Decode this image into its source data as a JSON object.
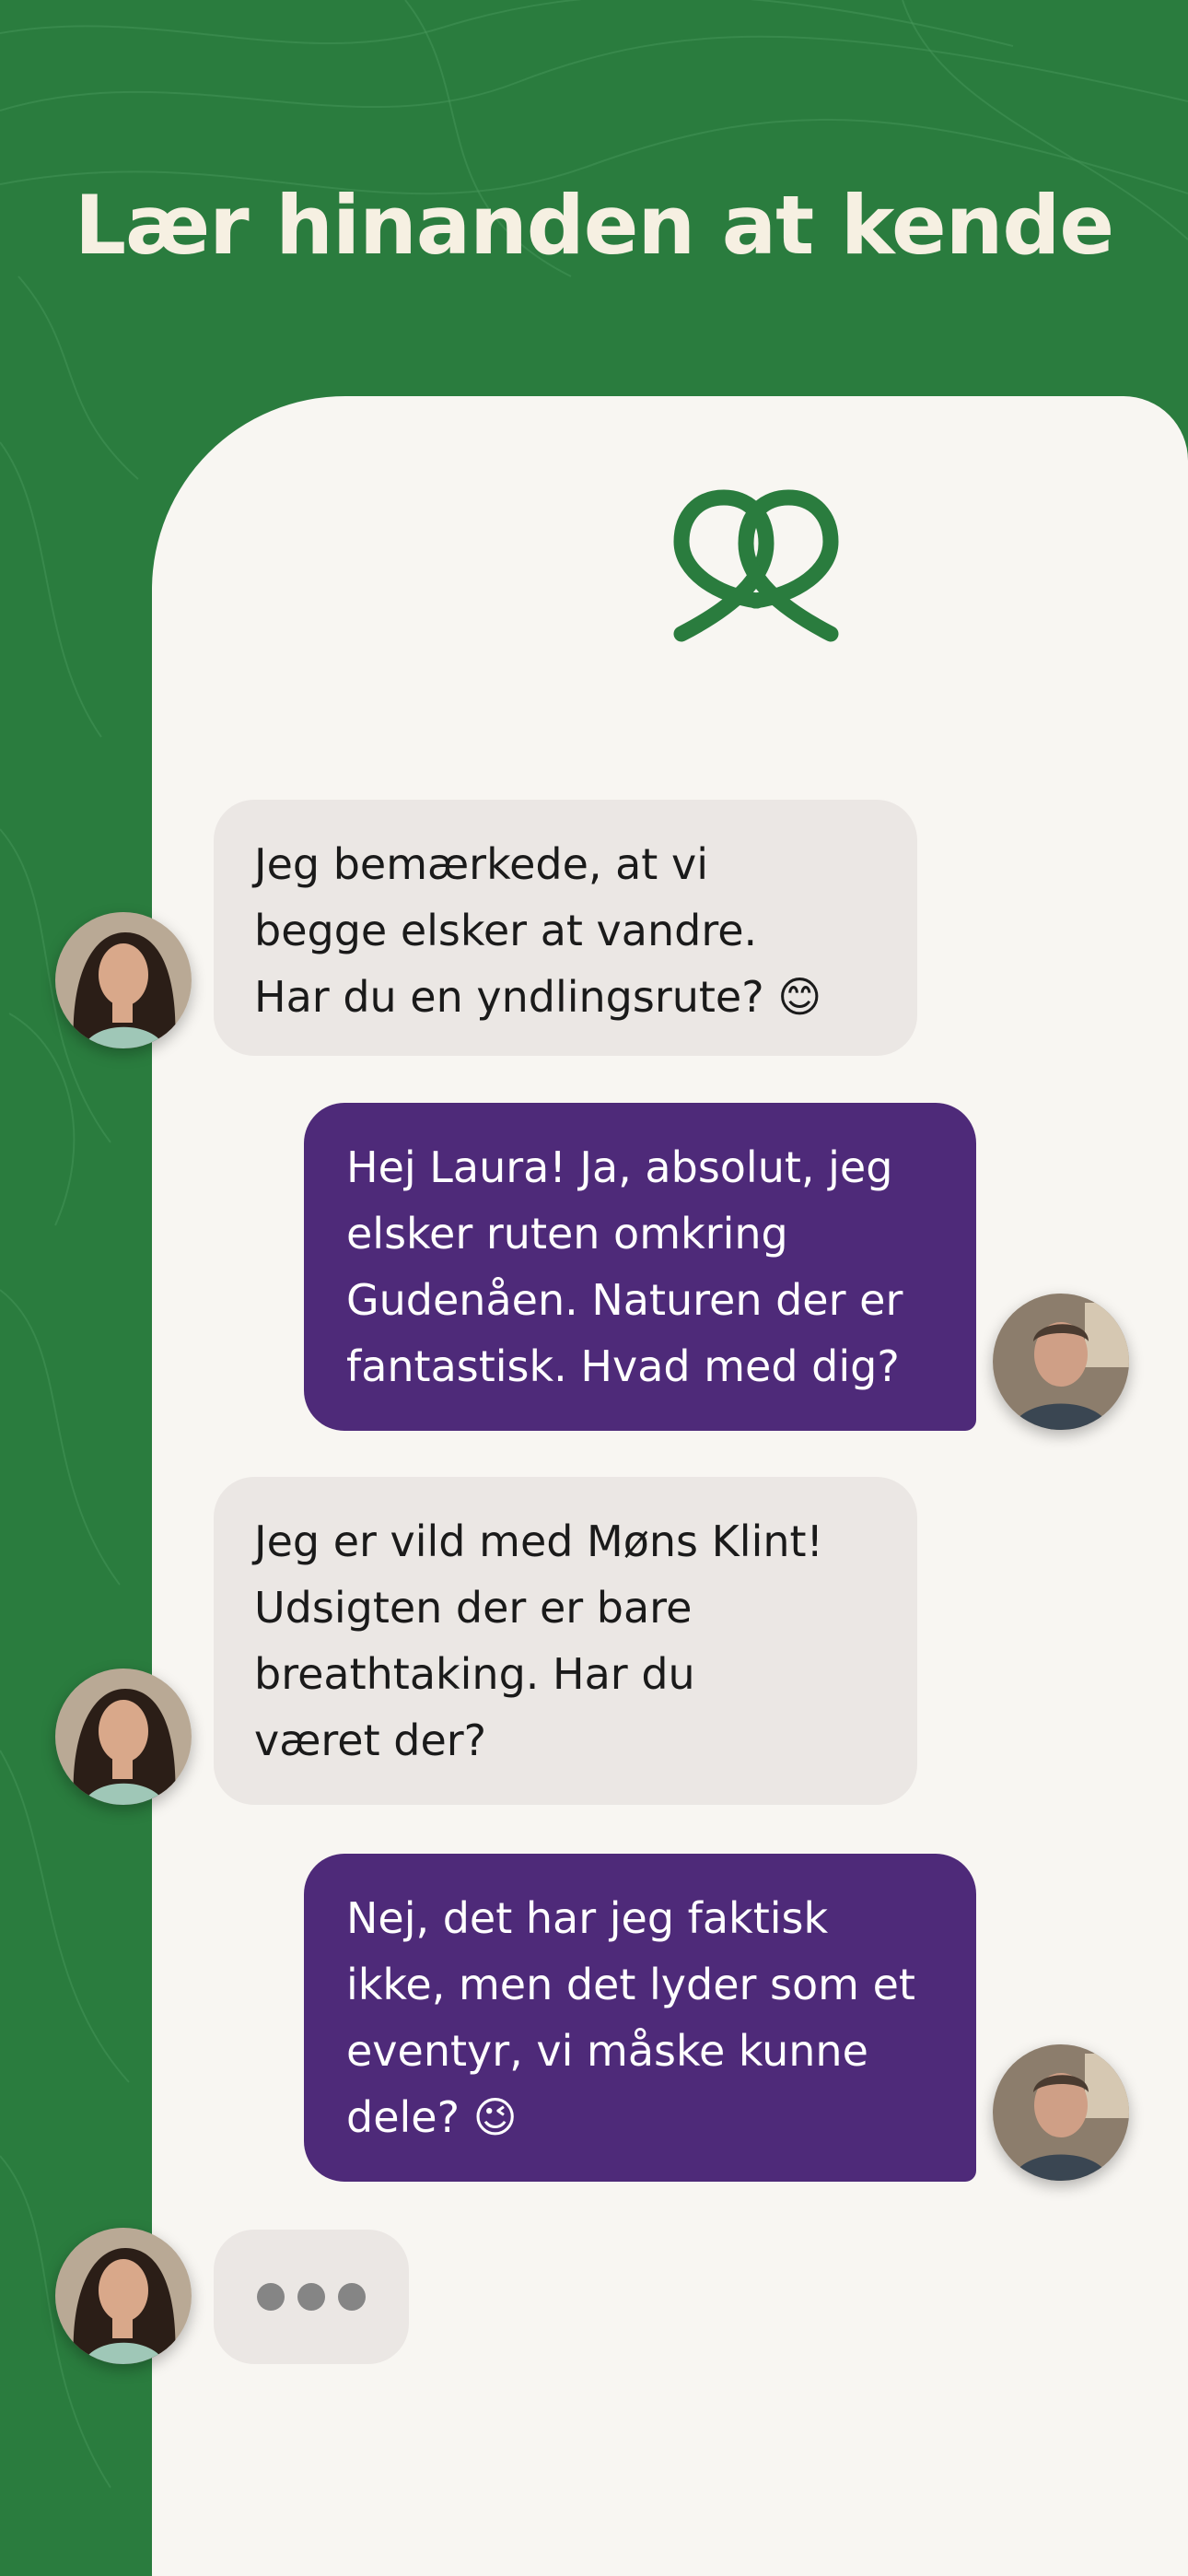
{
  "headline": "Lær hinanden at kende",
  "brand": {
    "background_green": "#2a7c3e",
    "headline_color": "#f6f0e2",
    "panel_color": "#f8f6f2",
    "incoming_bubble": "#ebe7e4",
    "outgoing_bubble": "#4e2a79",
    "logo": "heart-knot-logo-icon"
  },
  "messages": [
    {
      "sender": "her",
      "text": "Jeg bemærkede, at vi\nbegge elsker at vandre.\nHar du en yndlingsrute? 😊"
    },
    {
      "sender": "him",
      "text": "Hej Laura! Ja, absolut, jeg\nelsker ruten omkring\nGudenåen. Naturen der er\nfantastisk. Hvad med dig?"
    },
    {
      "sender": "her",
      "text": "Jeg er vild med Møns Klint!\nUdsigten der er bare\nbreathtaking. Har du\nværet der?"
    },
    {
      "sender": "him",
      "text": "Nej, det har jeg faktisk\nikke, men det lyder som et\neventyr, vi måske kunne\ndele? 😉"
    }
  ],
  "typing_indicator": {
    "sender": "her",
    "dots": 3
  }
}
